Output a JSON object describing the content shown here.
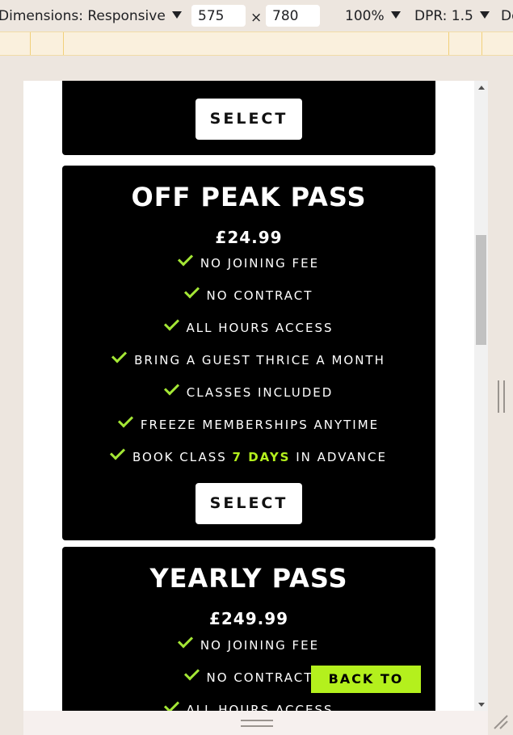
{
  "devtools": {
    "dimensions_label": "Dimensions: Responsive",
    "width_value": "575",
    "times": "×",
    "height_value": "780",
    "zoom_label": "100%",
    "dpr_label": "DPR: 1.5",
    "more_label": "De"
  },
  "previous_card": {
    "select_label": "SELECT"
  },
  "off_peak": {
    "title": "OFF PEAK PASS",
    "price": "£24.99",
    "features": [
      {
        "text": "NO JOINING FEE"
      },
      {
        "text": "NO CONTRACT"
      },
      {
        "text": "ALL HOURS ACCESS"
      },
      {
        "text": "BRING A GUEST THRICE A MONTH"
      },
      {
        "text": "CLASSES INCLUDED"
      },
      {
        "text": "FREEZE MEMBERSHIPS ANYTIME"
      },
      {
        "prefix": "BOOK CLASS ",
        "highlight": "7 DAYS",
        "suffix": " IN ADVANCE"
      }
    ],
    "select_label": "SELECT"
  },
  "yearly": {
    "title": "YEARLY PASS",
    "price": "£249.99",
    "features": [
      {
        "text": "NO JOINING FEE"
      },
      {
        "text": "NO CONTRACT"
      },
      {
        "text": "ALL HOURS ACCESS"
      }
    ]
  },
  "back_to_top_label": "BACK TO TOP",
  "colors": {
    "accent": "#b4f01d",
    "check": "#a3e635",
    "card_bg": "#000000"
  },
  "icons": [
    "caret-down-icon",
    "check-icon",
    "scroll-up-arrow-icon",
    "scroll-down-arrow-icon",
    "resize-grip-icon"
  ]
}
